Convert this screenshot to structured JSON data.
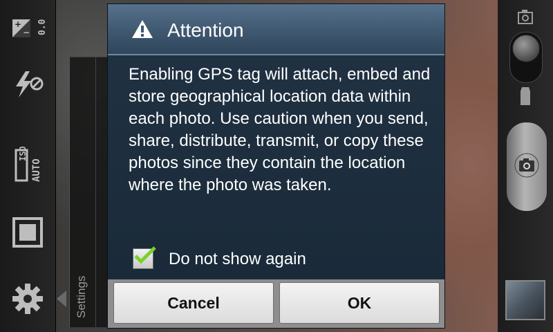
{
  "left_toolbar": {
    "exposure_value": "0.0",
    "iso_value": "ISO",
    "iso_mode": "AUTO",
    "items": [
      {
        "icon": "exposure-icon"
      },
      {
        "icon": "flash-off-icon"
      },
      {
        "icon": "iso-auto-icon"
      },
      {
        "icon": "frame-icon"
      },
      {
        "icon": "gear-icon"
      }
    ]
  },
  "settings_panel": {
    "label": "Settings"
  },
  "dialog": {
    "title": "Attention",
    "title_icon": "warning-icon",
    "message": "Enabling GPS tag will attach, embed and store geographical location data within each photo. Use caution when you send, share, distribute, transmit, or copy these photos since they contain the location where the photo was taken.",
    "checkbox_label": "Do not show again",
    "checkbox_checked": true,
    "cancel_label": "Cancel",
    "ok_label": "OK",
    "check_color": "#7bd12e",
    "header_color": "#4a6680",
    "body_color": "#1d2d3c"
  },
  "right_controls": {
    "mode_switch": [
      "camera-icon",
      "video-icon"
    ],
    "shutter_icon": "camera-icon",
    "thumbnail": "gallery-thumbnail"
  }
}
